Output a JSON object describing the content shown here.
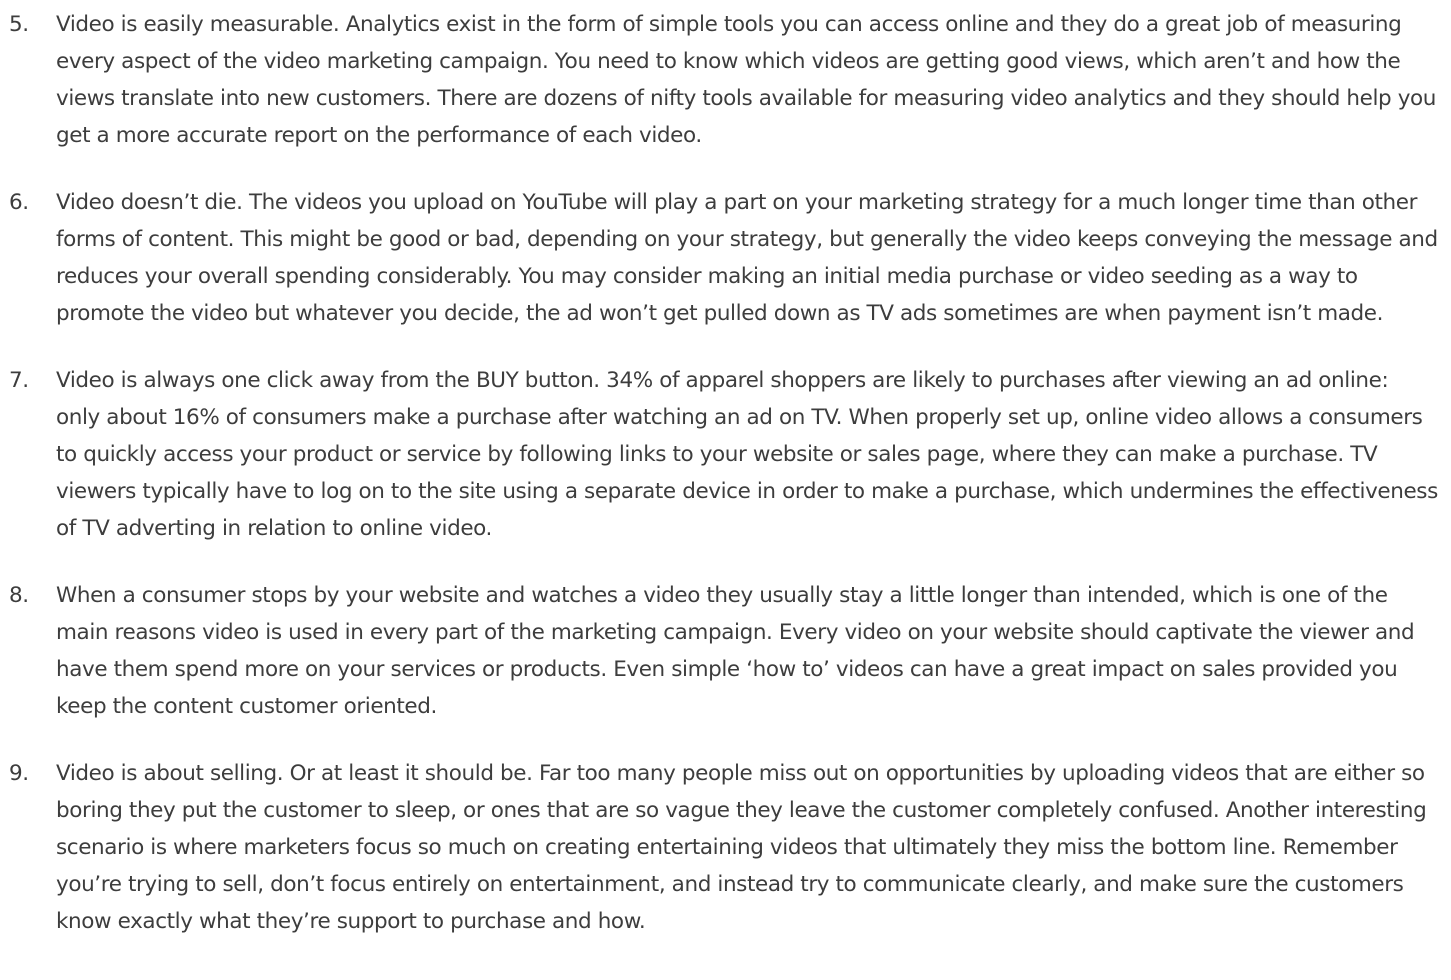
{
  "article": {
    "items": [
      {
        "number": "5.",
        "text": "Video is easily measurable. Analytics exist in the form of simple tools you can access online and they do a great job of measuring every aspect of the video marketing campaign. You need to know which videos are getting good views, which aren’t and how the views translate into new customers. There are dozens of nifty tools available for measuring video analytics and they should help you get a more accurate report on the performance of each video."
      },
      {
        "number": "6.",
        "text": "Video doesn’t die. The videos you upload on YouTube will play a part on your marketing strategy for a much longer time than other forms of content. This might be good or bad, depending on your strategy, but generally the video keeps conveying the message and reduces your overall spending considerably. You may consider making an initial media purchase or video seeding as a way to promote the video but whatever you decide, the ad won’t get pulled down as TV ads sometimes are when payment isn’t made."
      },
      {
        "number": "7.",
        "text": "Video is always one click away from the BUY button. 34% of apparel shoppers are likely to purchases after viewing an ad online: only about 16% of consumers make a purchase after watching an ad on TV. When properly set up, online video allows a consumers to quickly access your product or service by following links to your website or sales page, where they can make a purchase. TV viewers typically have to log on to the site using a separate device in order to make a purchase, which undermines the effectiveness of TV adverting in relation to online video."
      },
      {
        "number": "8.",
        "text": "When a consumer stops by your website and watches a video they usually stay a little longer than intended, which is one of the main reasons video is used in every part of the marketing campaign. Every video on your website should captivate the viewer and have them spend more on your services or products. Even simple ‘how to’ videos can have a great impact on sales provided you keep the content customer oriented."
      },
      {
        "number": "9.",
        "text": "Video is about selling. Or at least it should be. Far too many people miss out on opportunities by uploading videos that are either so boring they put the customer to sleep, or ones that are so vague they leave the customer completely confused. Another interesting scenario is where marketers focus so much on creating entertaining videos that ultimately they miss the bottom line. Remember you’re trying to sell, don’t focus entirely on entertainment, and instead try to communicate clearly, and make sure the customers know exactly what they’re support to purchase and how."
      }
    ]
  }
}
